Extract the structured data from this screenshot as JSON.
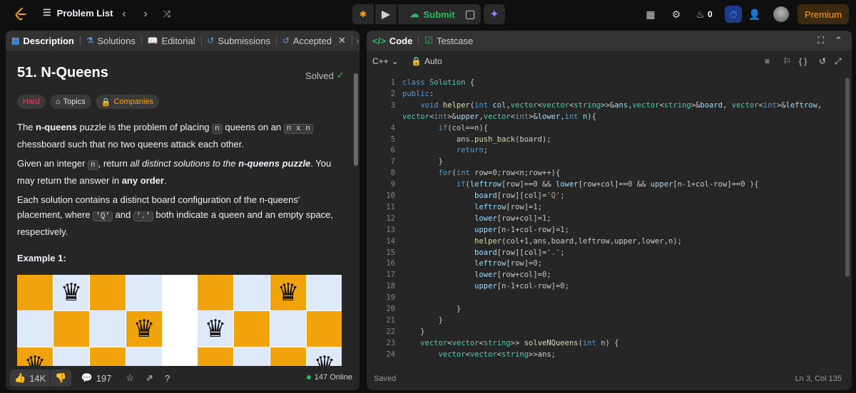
{
  "topbar": {
    "problem_list": "Problem List",
    "submit": "Submit",
    "streak": "0",
    "premium": "Premium"
  },
  "left": {
    "tabs": [
      "Description",
      "Solutions",
      "Editorial",
      "Submissions",
      "Accepted"
    ],
    "title": "51. N-Queens",
    "solved": "Solved",
    "chips": [
      "Hard",
      "Topics",
      "Companies"
    ],
    "p1_a": "The ",
    "p1_b": "n-queens",
    "p1_c": " puzzle is the problem of placing ",
    "p1_d": "n",
    "p1_e": " queens on an ",
    "p1_f": "n x n",
    "p1_g": " chessboard such that no two queens attack each other.",
    "p2_a": "Given an integer ",
    "p2_b": "n",
    "p2_c": ", return ",
    "p2_d": "all distinct solutions to the ",
    "p2_e": "n-queens puzzle",
    "p2_f": ". You may return the answer in ",
    "p2_g": "any order",
    "p2_h": ".",
    "p3_a": "Each solution contains a distinct board configuration of the n-queens' placement, where ",
    "p3_b": "'Q'",
    "p3_c": " and ",
    "p3_d": "'.'",
    "p3_e": " both indicate a queen and an empty space, respectively.",
    "example": "Example 1:",
    "likes": "14K",
    "comments": "197",
    "online": "147 Online"
  },
  "right": {
    "tab_code": "Code",
    "tab_testcase": "Testcase",
    "lang": "C++",
    "auto": "Auto",
    "saved": "Saved",
    "position": "Ln 3, Col 135",
    "line_numbers": [
      "1",
      "2",
      "3",
      "",
      "4",
      "5",
      "6",
      "7",
      "8",
      "9",
      "10",
      "11",
      "12",
      "13",
      "14",
      "15",
      "16",
      "17",
      "18",
      "19",
      "20",
      "21",
      "22",
      "23",
      "24"
    ]
  },
  "colors": {
    "accent": "#ffa116",
    "green": "#2cbb5d",
    "hard": "#ff375f",
    "board_dark": "#f0a30a",
    "board_light": "#dde8f8"
  }
}
